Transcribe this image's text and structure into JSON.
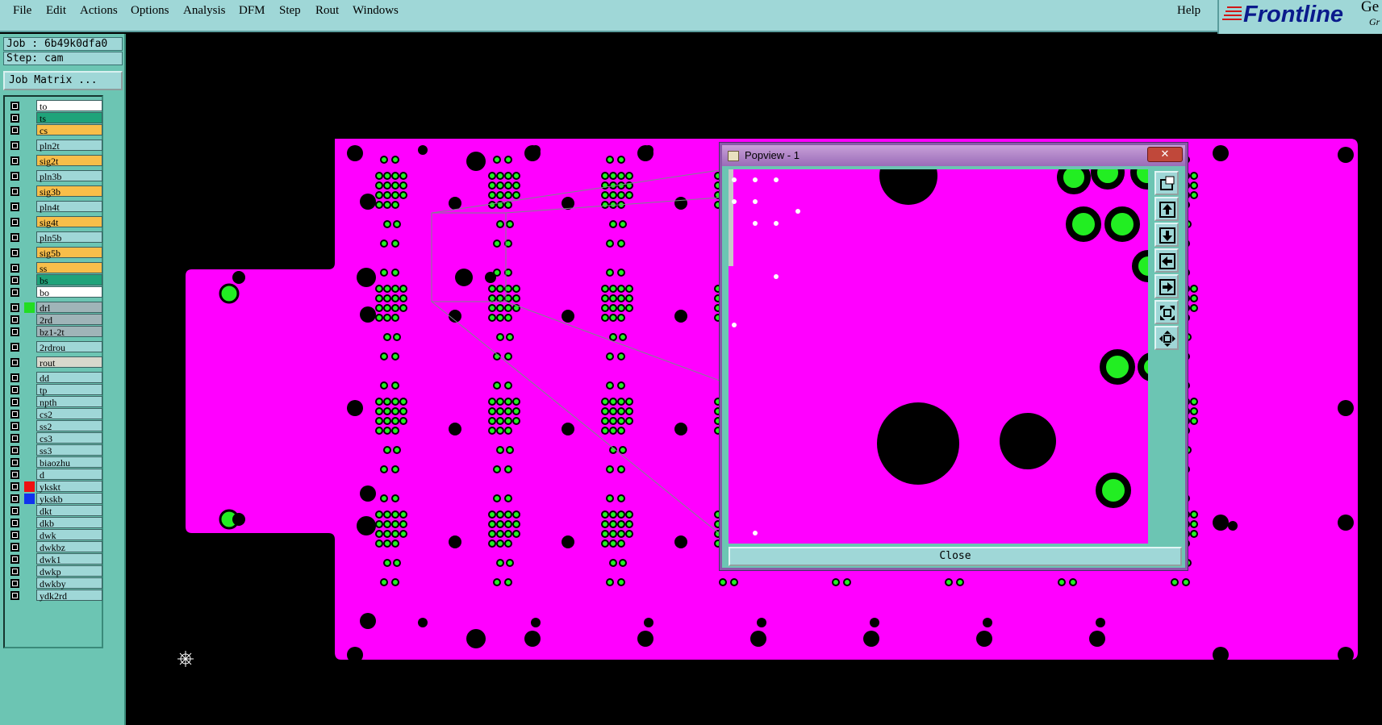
{
  "menu": {
    "items": [
      {
        "label": "File",
        "key": "file"
      },
      {
        "label": "Edit",
        "key": "edit"
      },
      {
        "label": "Actions",
        "key": "actions"
      },
      {
        "label": "Options",
        "key": "options"
      },
      {
        "label": "Analysis",
        "key": "analysis"
      },
      {
        "label": "DFM",
        "key": "dfm"
      },
      {
        "label": "Step",
        "key": "step"
      },
      {
        "label": "Rout",
        "key": "rout"
      },
      {
        "label": "Windows",
        "key": "windows"
      }
    ],
    "help": "Help"
  },
  "logo": {
    "brand": "Frontline",
    "ge": "Ge",
    "gr": "Gr"
  },
  "info": {
    "job": "Job : 6b49k0dfa0",
    "step": "Step: cam",
    "job_matrix": "Job Matrix ..."
  },
  "layers": [
    {
      "name": "to",
      "bg": "#ffffff",
      "swatch": null
    },
    {
      "name": "ts",
      "bg": "#1fa37a",
      "swatch": null
    },
    {
      "name": "cs",
      "bg": "#f8be4a",
      "swatch": null
    },
    {
      "name": "pln2t",
      "bg": "#9fd7d7",
      "swatch": null
    },
    {
      "name": "sig2t",
      "bg": "#f8be4a",
      "swatch": null
    },
    {
      "name": "pln3b",
      "bg": "#9fd7d7",
      "swatch": null
    },
    {
      "name": "sig3b",
      "bg": "#f8be4a",
      "swatch": null
    },
    {
      "name": "pln4t",
      "bg": "#9fd7d7",
      "swatch": null
    },
    {
      "name": "sig4t",
      "bg": "#f8be4a",
      "swatch": null
    },
    {
      "name": "pln5b",
      "bg": "#9fd7d7",
      "swatch": null
    },
    {
      "name": "sig5b",
      "bg": "#f8be4a",
      "swatch": null
    },
    {
      "name": "ss",
      "bg": "#f8be4a",
      "swatch": null
    },
    {
      "name": "bs",
      "bg": "#1fa37a",
      "swatch": null
    },
    {
      "name": "bo",
      "bg": "#ffffff",
      "swatch": null
    },
    {
      "name": "drl",
      "bg": "#a0b4b8",
      "swatch": "#22dd22"
    },
    {
      "name": "2rd",
      "bg": "#a0b4b8",
      "swatch": null
    },
    {
      "name": "bz1-2t",
      "bg": "#a0b4b8",
      "swatch": null
    },
    {
      "name": "2rdrou",
      "bg": "#9fd7d7",
      "swatch": null
    },
    {
      "name": "rout",
      "bg": "#d8d8cc",
      "swatch": null
    },
    {
      "name": "dd",
      "bg": "#9fd7d7",
      "swatch": null
    },
    {
      "name": "tp",
      "bg": "#9fd7d7",
      "swatch": null
    },
    {
      "name": "npth",
      "bg": "#9fd7d7",
      "swatch": null
    },
    {
      "name": "cs2",
      "bg": "#9fd7d7",
      "swatch": null
    },
    {
      "name": "ss2",
      "bg": "#9fd7d7",
      "swatch": null
    },
    {
      "name": "cs3",
      "bg": "#9fd7d7",
      "swatch": null
    },
    {
      "name": "ss3",
      "bg": "#9fd7d7",
      "swatch": null
    },
    {
      "name": "biaozhu",
      "bg": "#9fd7d7",
      "swatch": null
    },
    {
      "name": "d",
      "bg": "#9fd7d7",
      "swatch": null
    },
    {
      "name": "ykskt",
      "bg": "#9fd7d7",
      "swatch": "#ee1111"
    },
    {
      "name": "ykskb",
      "bg": "#9fd7d7",
      "swatch": "#1133ee"
    },
    {
      "name": "dkt",
      "bg": "#9fd7d7",
      "swatch": null
    },
    {
      "name": "dkb",
      "bg": "#9fd7d7",
      "swatch": null
    },
    {
      "name": "dwk",
      "bg": "#9fd7d7",
      "swatch": null
    },
    {
      "name": "dwkbz",
      "bg": "#9fd7d7",
      "swatch": null
    },
    {
      "name": "dwk1",
      "bg": "#9fd7d7",
      "swatch": null
    },
    {
      "name": "dwkp",
      "bg": "#9fd7d7",
      "swatch": null
    },
    {
      "name": "dwkby",
      "bg": "#9fd7d7",
      "swatch": null
    },
    {
      "name": "ydk2rd",
      "bg": "#9fd7d7",
      "swatch": null
    }
  ],
  "popview": {
    "title": "Popview - 1",
    "close_x": "✕",
    "close_button": "Close",
    "tools": [
      "zoom-window-icon",
      "pan-up-icon",
      "pan-down-icon",
      "pan-left-icon",
      "pan-right-icon",
      "zoom-home-icon",
      "fit-all-icon"
    ]
  },
  "colors": {
    "board": "#ff00ff",
    "pad": "#22ee22",
    "background": "#000000",
    "panel": "#6cc5b3"
  }
}
